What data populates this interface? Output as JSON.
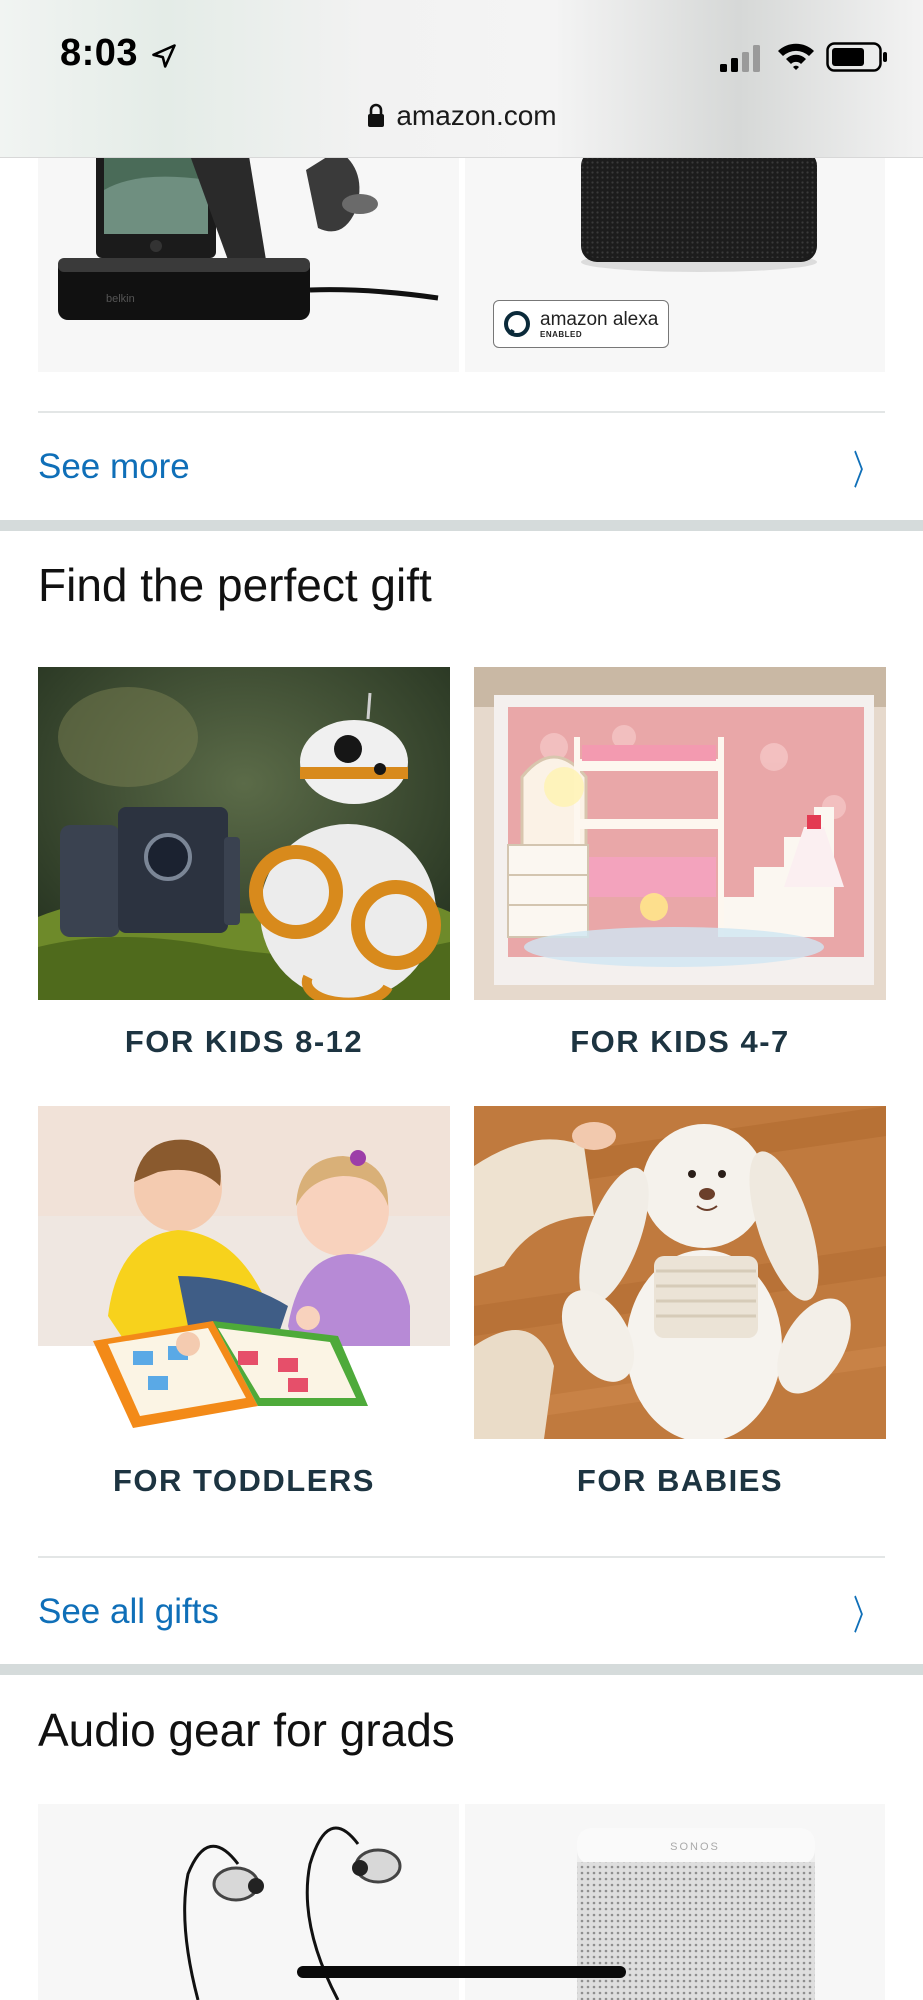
{
  "status_bar": {
    "time": "8:03",
    "icons": [
      "location-arrow-icon",
      "cellular-signal-icon",
      "wifi-icon",
      "battery-icon"
    ]
  },
  "url_bar": {
    "lock_icon": "lock-icon",
    "url": "amazon.com"
  },
  "top_products": {
    "badge_text": "amazon alexa",
    "badge_sub": "ENABLED",
    "brand_text": "belkin"
  },
  "see_more": {
    "label": "See more",
    "icon": "chevron-right-icon"
  },
  "gift_section": {
    "title": "Find the perfect gift",
    "items": [
      {
        "label": "FOR KIDS 8-12"
      },
      {
        "label": "FOR KIDS 4-7"
      },
      {
        "label": "FOR TODDLERS"
      },
      {
        "label": "FOR BABIES"
      }
    ],
    "see_all": "See all gifts"
  },
  "audio_section": {
    "title": "Audio gear for grads",
    "speaker_brand": "SONOS"
  },
  "colors": {
    "link": "#0f6fb8",
    "caption": "#1d3441",
    "band": "#d5dbdb",
    "divider": "#e3e6e6"
  }
}
